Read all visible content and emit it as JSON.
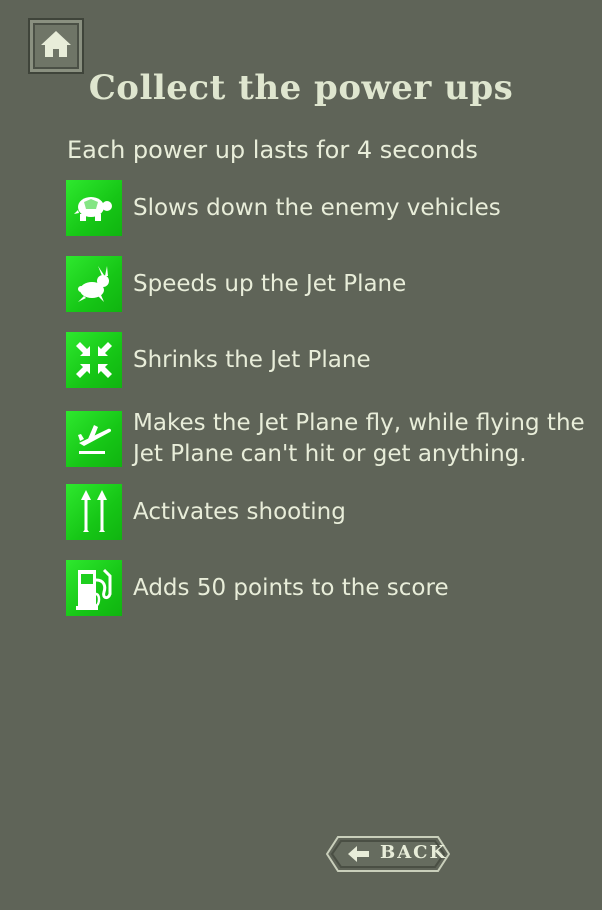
{
  "header": {
    "home_icon": "home-icon",
    "title": "Collect the power ups"
  },
  "subtitle": "Each power up lasts for 4 seconds",
  "powerups": [
    {
      "icon": "turtle-icon",
      "text": "Slows down the enemy vehicles"
    },
    {
      "icon": "rabbit-icon",
      "text": "Speeds up the Jet Plane"
    },
    {
      "icon": "shrink-arrows-icon",
      "text": "Shrinks the Jet Plane"
    },
    {
      "icon": "plane-takeoff-icon",
      "text": "Makes the Jet Plane fly, while flying the Jet Plane can't hit or get anything."
    },
    {
      "icon": "double-arrow-up-icon",
      "text": "Activates shooting"
    },
    {
      "icon": "fuel-pump-icon",
      "text": "Adds 50 points to the score"
    }
  ],
  "footer": {
    "back_label": "BACK",
    "back_icon": "arrow-left-icon"
  },
  "colors": {
    "background": "#5f6458",
    "text": "#e8edd9",
    "powerup_green": "#16c616"
  }
}
